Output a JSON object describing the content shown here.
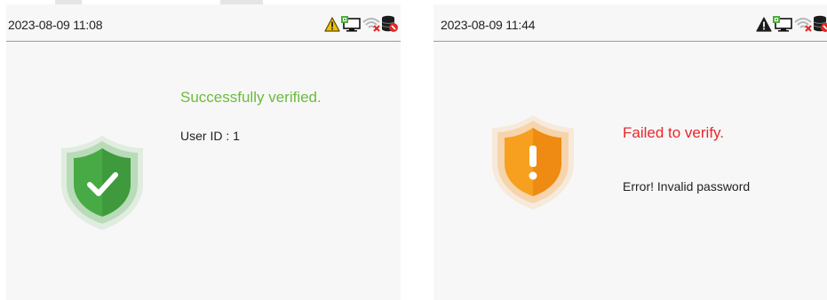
{
  "colors": {
    "success": "#6dbb3c",
    "failure": "#e8272c",
    "shield_success": "#45a843",
    "shield_failure": "#f5941f",
    "warning": "#f2c000"
  },
  "left_screen": {
    "status_bar": {
      "datetime": "2023-08-09 11:08",
      "icons": [
        "warning-triangle-icon",
        "network-connected-icon",
        "wifi-disconnected-icon",
        "server-disconnected-icon"
      ]
    },
    "result": {
      "icon": "shield-check-icon",
      "title": "Successfully verified.",
      "detail": "User ID : 1"
    }
  },
  "right_screen": {
    "status_bar": {
      "datetime": "2023-08-09 11:44",
      "icons": [
        "warning-triangle-icon",
        "network-connected-icon",
        "wifi-disconnected-icon",
        "server-disconnected-icon"
      ]
    },
    "result": {
      "icon": "shield-exclamation-icon",
      "title": "Failed to verify.",
      "detail": "Error! Invalid password"
    }
  }
}
